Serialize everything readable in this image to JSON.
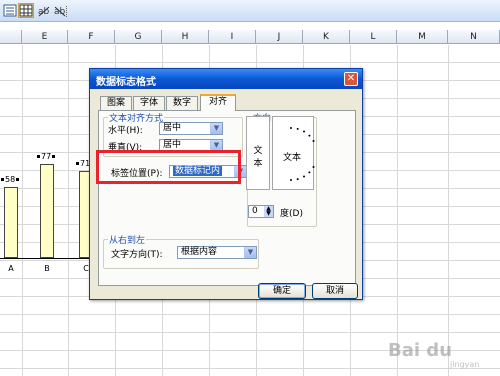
{
  "sheet": {
    "columns": [
      "E",
      "F",
      "G",
      "H",
      "I",
      "J",
      "K",
      "L",
      "M",
      "N"
    ]
  },
  "chart_data": {
    "type": "bar",
    "categories": [
      "A",
      "B",
      "C"
    ],
    "values": [
      58,
      77,
      71
    ],
    "data_labels": [
      "58",
      "77",
      "71"
    ],
    "title": "",
    "xlabel": "",
    "ylabel": ""
  },
  "dialog": {
    "title": "数据标志格式",
    "tabs": [
      "图案",
      "字体",
      "数字",
      "对齐"
    ],
    "active_tab": "对齐",
    "text_align_group": "文本对齐方式",
    "horizontal_label": "水平(H):",
    "horizontal_value": "居中",
    "vertical_label": "垂直(V):",
    "vertical_value": "居中",
    "label_position_label": "标签位置(P):",
    "label_position_value": "数据标记内",
    "orientation_group": "方向",
    "orientation_vertical_text": "文本",
    "orientation_dial_text": "文本",
    "degree_value": "0",
    "degree_label": "度(D)",
    "rtl_group": "从右到左",
    "text_direction_label": "文字方向(T):",
    "text_direction_value": "根据内容",
    "ok_label": "确定",
    "cancel_label": "取消",
    "close_glyph": "✕"
  },
  "watermark": {
    "brand": "Bai du",
    "sub": "jingyan"
  },
  "colors": {
    "highlight": "#e8232b",
    "title_bar": "#0a58d6",
    "bar_fill": "#ffffc6"
  }
}
